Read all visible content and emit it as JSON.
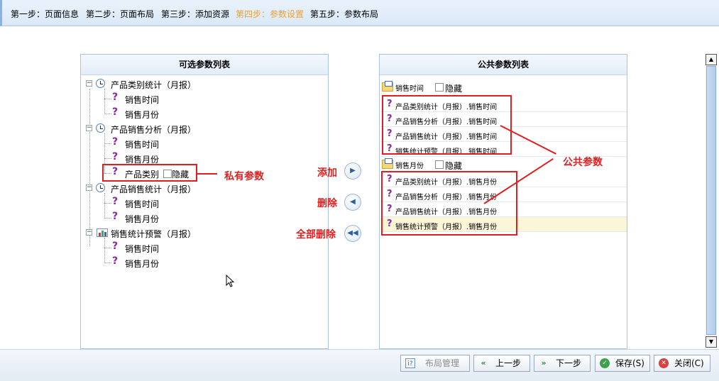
{
  "steps": [
    {
      "label": "第一步：页面信息",
      "active": false
    },
    {
      "label": "第二步：页面布局",
      "active": false
    },
    {
      "label": "第三步：添加资源",
      "active": false
    },
    {
      "label": "第四步：参数设置",
      "active": true
    },
    {
      "label": "第五步：参数布局",
      "active": false
    }
  ],
  "left_panel": {
    "title": "可选参数列表",
    "groups": [
      {
        "label": "产品类别统计（月报）",
        "icon": "clock-icon",
        "items": [
          "销售时间",
          "销售月份"
        ]
      },
      {
        "label": "产品销售分析（月报）",
        "icon": "clock-icon",
        "items": [
          "销售时间",
          "销售月份",
          "产品类别"
        ]
      },
      {
        "label": "产品销售统计（月报）",
        "icon": "clock-icon",
        "items": [
          "销售时间",
          "销售月份"
        ]
      },
      {
        "label": "销售统计预警（月报）",
        "icon": "chart-icon",
        "items": [
          "销售时间",
          "销售月份"
        ]
      }
    ],
    "hide_label": "隐藏"
  },
  "controls": {
    "add": "添加",
    "delete": "删除",
    "delete_all": "全部删除"
  },
  "right_panel": {
    "title": "公共参数列表",
    "hide_label": "隐藏",
    "groups": [
      {
        "label": "销售时间",
        "items": [
          "产品类别统计（月报）.销售时间",
          "产品销售分析（月报）.销售时间",
          "产品销售统计（月报）.销售时间",
          "销售统计预警（月报）.销售时间"
        ]
      },
      {
        "label": "销售月份",
        "items": [
          "产品类别统计（月报）.销售月份",
          "产品销售分析（月报）.销售月份",
          "产品销售统计（月报）.销售月份",
          "销售统计预警（月报）.销售月份"
        ]
      }
    ]
  },
  "annotations": {
    "private": "私有参数",
    "public": "公共参数"
  },
  "footer": {
    "layout": "布局管理",
    "prev": "上一步",
    "next": "下一步",
    "save": "保存(S)",
    "close": "关闭(C)"
  },
  "colors": {
    "accent": "#f0a030",
    "annotation": "#e02020",
    "tree_qmark": "#8a2a9c"
  }
}
